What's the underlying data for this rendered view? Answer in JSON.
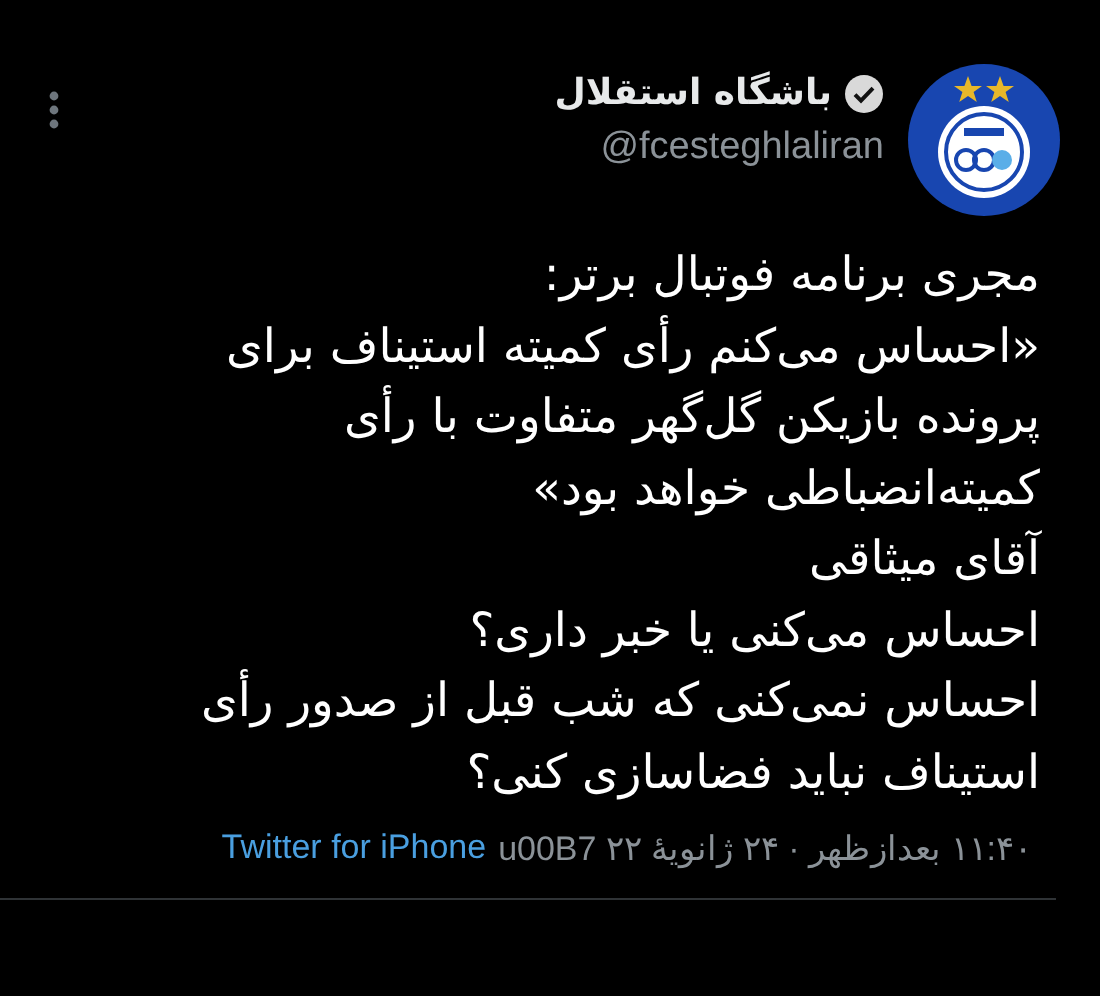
{
  "author": {
    "name": "باشگاه استقلال",
    "verified": true,
    "handle": "@fcesteghlaliran"
  },
  "tweet": {
    "text": "مجری برنامه فوتبال برتر:\n«احساس می‌کنم رأی کمیته استیناف برای\nپرونده بازیکن گل‌گهر متفاوت با رأی\nکمیته‌انضباطی خواهد بود»\nآقای میثاقی\nاحساس می‌کنی یا خبر داری؟\nاحساس نمی‌کنی که شب قبل از صدور رأی\nاستیناف نباید فضاسازی کنی؟"
  },
  "meta": {
    "timestamp": "۱۱:۴۰ بعدازظهر · ۲۴ ژانویهٔ ۲۲ u00B7",
    "source": "Twitter for iPhone"
  }
}
